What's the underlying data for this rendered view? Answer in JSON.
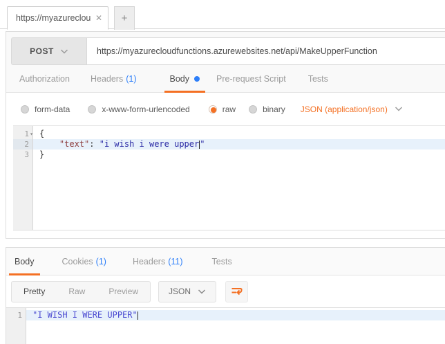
{
  "browser_tab": {
    "title": "https://myazurecloud",
    "close_icon": "✕",
    "new_tab_icon": "+"
  },
  "request": {
    "method": "POST",
    "url": "https://myazurecloudfunctions.azurewebsites.net/api/MakeUpperFunction",
    "tabs": [
      {
        "label": "Authorization"
      },
      {
        "label": "Headers",
        "count": "(1)"
      },
      {
        "label": "Body"
      },
      {
        "label": "Pre-request Script"
      },
      {
        "label": "Tests"
      }
    ],
    "body_modes": [
      {
        "label": "form-data"
      },
      {
        "label": "x-www-form-urlencoded"
      },
      {
        "label": "raw"
      },
      {
        "label": "binary"
      }
    ],
    "content_type": "JSON (application/json)",
    "editor": {
      "line_numbers": [
        "1",
        "2",
        "3"
      ],
      "fold_marker": "▾",
      "line1": "{",
      "line2_indent": "    ",
      "line2_key": "\"text\"",
      "line2_sep": ": ",
      "line2_value": "\"i wish i were upper",
      "line2_close": "\"",
      "line3": "}"
    }
  },
  "response": {
    "tabs": [
      {
        "label": "Body"
      },
      {
        "label": "Cookies",
        "count": "(1)"
      },
      {
        "label": "Headers",
        "count": "(11)"
      },
      {
        "label": "Tests"
      }
    ],
    "view_modes": [
      {
        "label": "Pretty"
      },
      {
        "label": "Raw"
      },
      {
        "label": "Preview"
      }
    ],
    "format": "JSON",
    "editor": {
      "line_number": "1",
      "line1": "\"I WISH I WERE UPPER\""
    }
  },
  "colors": {
    "accent_orange": "#f47023",
    "link_blue": "#2d7ff9",
    "json_key": "#8b3a3a",
    "json_string_request": "#2a2aa5",
    "json_string_response": "#4b4bd1",
    "line_highlight": "#e7f1fb"
  }
}
